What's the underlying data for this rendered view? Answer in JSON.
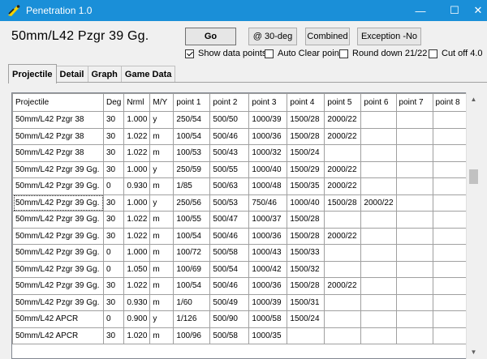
{
  "window": {
    "title": "Penetration 1.0",
    "minimize_glyph": "—",
    "maximize_glyph": "☐",
    "close_glyph": "✕"
  },
  "header": {
    "projectile_name": "50mm/L42 Pzgr 39 Gg.",
    "buttons": {
      "go": "Go",
      "angle": "@ 30-deg",
      "combined": "Combined",
      "exceptions": "Exception -No"
    },
    "checkboxes": [
      {
        "label": "Show data points",
        "checked": true
      },
      {
        "label": "Auto Clear points",
        "checked": false
      },
      {
        "label": "Round down 21/22",
        "checked": false
      },
      {
        "label": "Cut off 4.0",
        "checked": false
      }
    ]
  },
  "tabs": [
    "Projectile",
    "Detail",
    "Graph",
    "Game Data"
  ],
  "active_tab": "Projectile",
  "grid": {
    "columns": [
      "Projectile",
      "Deg",
      "Nrml",
      "M/Y",
      "point 1",
      "point 2",
      "point 3",
      "point 4",
      "point 5",
      "point 6",
      "point 7",
      "point 8"
    ],
    "rows": [
      [
        "50mm/L42 Pzgr 38",
        "30",
        "1.000",
        "y",
        "250/54",
        "500/50",
        "1000/39",
        "1500/28",
        "2000/22",
        "",
        "",
        ""
      ],
      [
        "50mm/L42 Pzgr 38",
        "30",
        "1.022",
        "m",
        "100/54",
        "500/46",
        "1000/36",
        "1500/28",
        "2000/22",
        "",
        "",
        ""
      ],
      [
        "50mm/L42 Pzgr 38",
        "30",
        "1.022",
        "m",
        "100/53",
        "500/43",
        "1000/32",
        "1500/24",
        "",
        "",
        "",
        ""
      ],
      [
        "50mm/L42 Pzgr 39 Gg.",
        "30",
        "1.000",
        "y",
        "250/59",
        "500/55",
        "1000/40",
        "1500/29",
        "2000/22",
        "",
        "",
        ""
      ],
      [
        "50mm/L42 Pzgr 39 Gg.",
        "0",
        "0.930",
        "m",
        "1/85",
        "500/63",
        "1000/48",
        "1500/35",
        "2000/22",
        "",
        "",
        ""
      ],
      [
        "50mm/L42 Pzgr 39 Gg.",
        "30",
        "1.000",
        "y",
        "250/56",
        "500/53",
        "750/46",
        "1000/40",
        "1500/28",
        "2000/22",
        "",
        ""
      ],
      [
        "50mm/L42 Pzgr 39 Gg.",
        "30",
        "1.022",
        "m",
        "100/55",
        "500/47",
        "1000/37",
        "1500/28",
        "",
        "",
        "",
        ""
      ],
      [
        "50mm/L42 Pzgr 39 Gg.",
        "30",
        "1.022",
        "m",
        "100/54",
        "500/46",
        "1000/36",
        "1500/28",
        "2000/22",
        "",
        "",
        ""
      ],
      [
        "50mm/L42 Pzgr 39 Gg.",
        "0",
        "1.000",
        "m",
        "100/72",
        "500/58",
        "1000/43",
        "1500/33",
        "",
        "",
        "",
        ""
      ],
      [
        "50mm/L42 Pzgr 39 Gg.",
        "0",
        "1.050",
        "m",
        "100/69",
        "500/54",
        "1000/42",
        "1500/32",
        "",
        "",
        "",
        ""
      ],
      [
        "50mm/L42 Pzgr 39 Gg.",
        "30",
        "1.022",
        "m",
        "100/54",
        "500/46",
        "1000/36",
        "1500/28",
        "2000/22",
        "",
        "",
        ""
      ],
      [
        "50mm/L42 Pzgr 39 Gg.",
        "30",
        "0.930",
        "m",
        "1/60",
        "500/49",
        "1000/39",
        "1500/31",
        "",
        "",
        "",
        ""
      ],
      [
        "50mm/L42 APCR",
        "0",
        "0.900",
        "y",
        "1/126",
        "500/90",
        "1000/58",
        "1500/24",
        "",
        "",
        "",
        ""
      ],
      [
        "50mm/L42 APCR",
        "30",
        "1.020",
        "m",
        "100/96",
        "500/58",
        "1000/35",
        "",
        "",
        "",
        "",
        ""
      ]
    ],
    "selected_row": 5
  },
  "colors": {
    "titlebar": "#1a8fd8",
    "window_bg": "#f0f0f0",
    "grid_bg": "#ffffff"
  }
}
